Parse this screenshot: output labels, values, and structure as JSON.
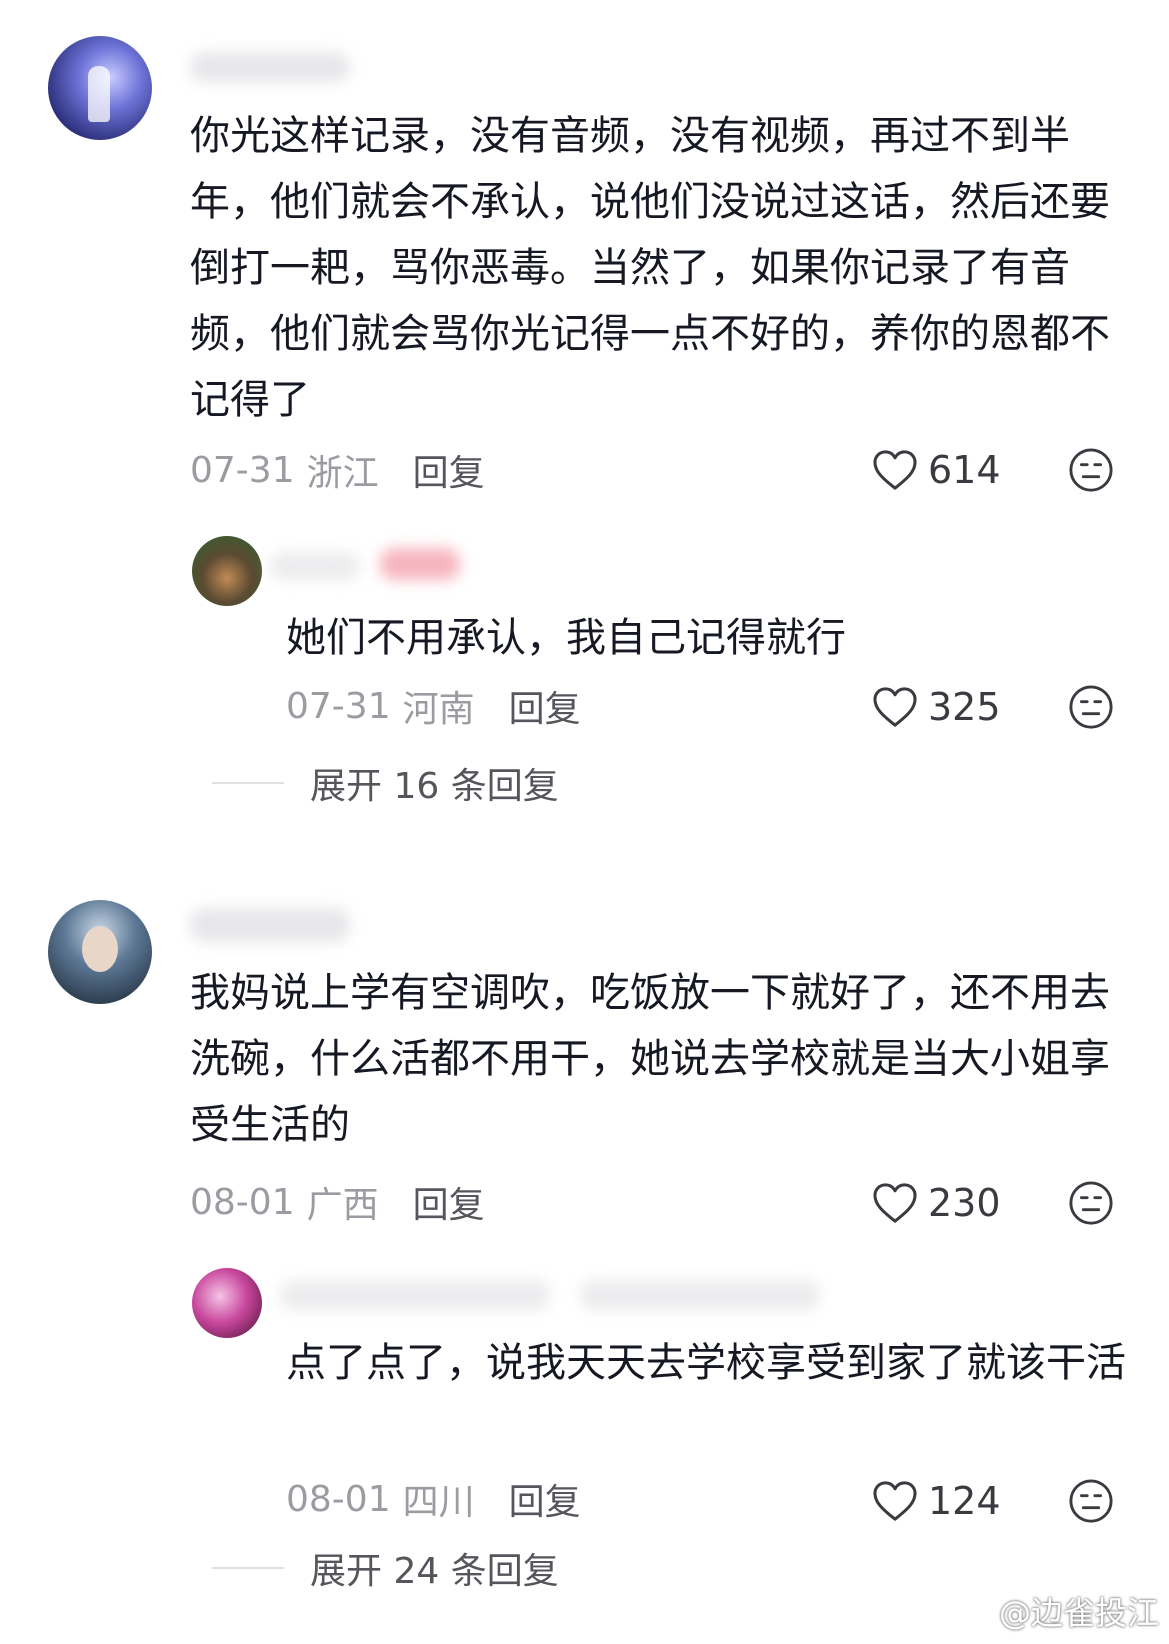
{
  "comments": [
    {
      "text": "你光这样记录，没有音频，没有视频，再过不到半年，他们就会不承认，说他们没说过这话，然后还要倒打一耙，骂你恶毒。当然了，如果你记录了有音频，他们就会骂你光记得一点不好的，养你的恩都不记得了",
      "date": "07-31",
      "location": "浙江",
      "reply_label": "回复",
      "likes": "614",
      "replies": [
        {
          "text": "她们不用承认，我自己记得就行",
          "date": "07-31",
          "location": "河南",
          "reply_label": "回复",
          "likes": "325"
        }
      ],
      "expand_label": "展开 16 条回复"
    },
    {
      "text": "我妈说上学有空调吹，吃饭放一下就好了，还不用去洗碗，什么活都不用干，她说去学校就是当大小姐享受生活的",
      "date": "08-01",
      "location": "广西",
      "reply_label": "回复",
      "likes": "230",
      "replies": [
        {
          "text": "点了点了，说我天天去学校享受到家了就该干活",
          "date": "08-01",
          "location": "四川",
          "reply_label": "回复",
          "likes": "124"
        }
      ],
      "expand_label": "展开 24 条回复"
    }
  ],
  "icons": {
    "like": "heart-outline-icon",
    "dislike": "neutral-face-icon",
    "watermark": "weibo-logo-icon"
  },
  "watermark": "@边雀投江",
  "colors": {
    "text": "#161823",
    "meta": "#9b9ba2",
    "reply": "#55555c"
  }
}
